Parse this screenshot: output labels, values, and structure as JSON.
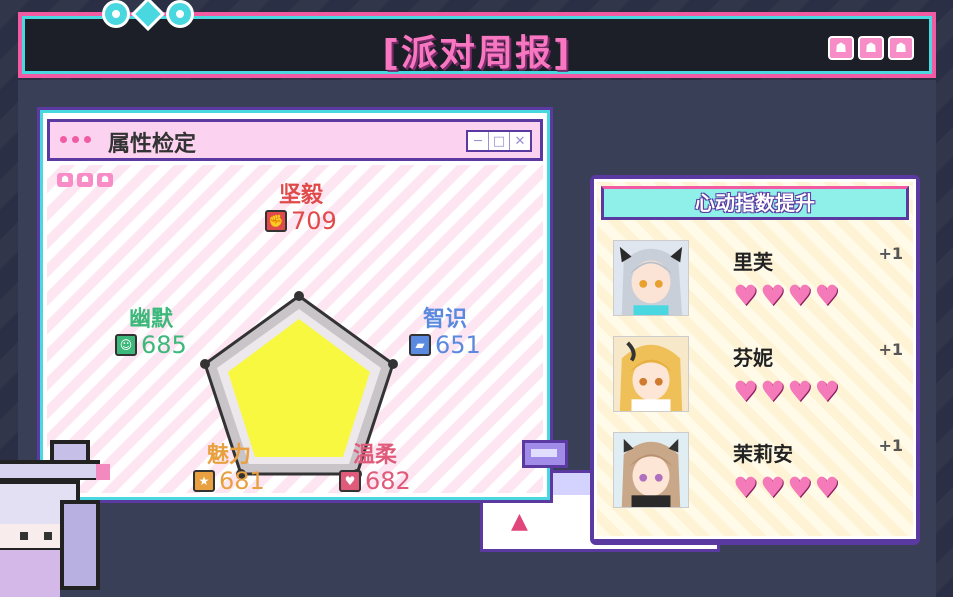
{
  "header": {
    "title": "[派对周报]",
    "icons": [
      "invader-icon",
      "invader-icon",
      "invader-icon"
    ]
  },
  "attributes": {
    "title": "属性检定",
    "window_buttons": [
      "minimize",
      "maximize",
      "close"
    ],
    "stats": [
      {
        "id": "tenacity",
        "label": "坚毅",
        "value": "709",
        "color": "#e04a4a",
        "icon": "fist-icon"
      },
      {
        "id": "intelligence",
        "label": "智识",
        "value": "651",
        "color": "#5a8adf",
        "icon": "book-icon"
      },
      {
        "id": "gentleness",
        "label": "温柔",
        "value": "682",
        "color": "#e05a7a",
        "icon": "heart-icon"
      },
      {
        "id": "charm",
        "label": "魅力",
        "value": "681",
        "color": "#e8a040",
        "icon": "star-icon"
      },
      {
        "id": "humor",
        "label": "幽默",
        "value": "685",
        "color": "#3cb87a",
        "icon": "smile-icon"
      }
    ],
    "radar_fill": 0.75
  },
  "affinity": {
    "title": "心动指数提升",
    "characters": [
      {
        "name": "里芙",
        "gain": "+1",
        "hearts": 4
      },
      {
        "name": "芬妮",
        "gain": "+1",
        "hearts": 4
      },
      {
        "name": "茉莉安",
        "gain": "+1",
        "hearts": 4
      }
    ]
  },
  "colors": {
    "accent_pink": "#f25ba3",
    "accent_cyan": "#4ad8e0",
    "accent_purple": "#5a3aa0",
    "radar_fill": "#f8f840"
  }
}
